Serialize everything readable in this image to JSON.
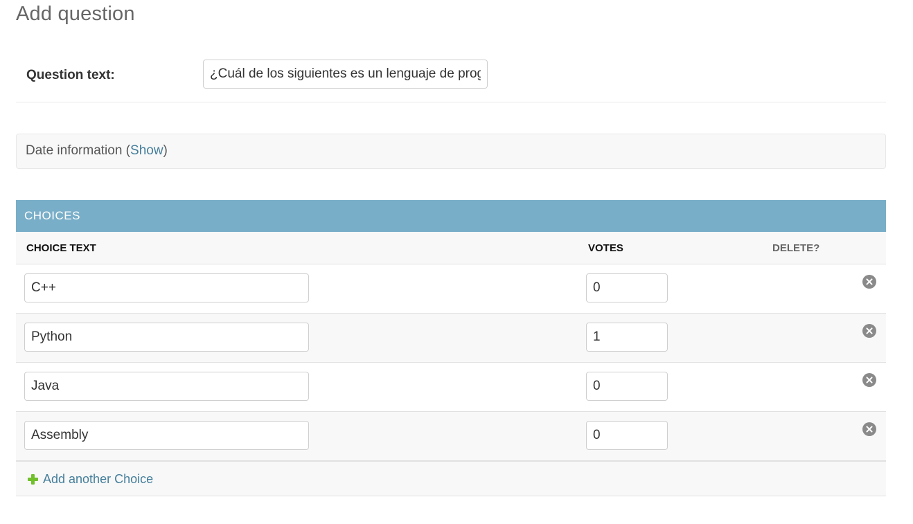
{
  "page": {
    "title": "Add question"
  },
  "question_field": {
    "label": "Question text:",
    "value": "¿Cuál de los siguientes es un lenguaje de programación?"
  },
  "date_section": {
    "title_prefix": "Date information (",
    "show_link": "Show",
    "title_suffix": ")"
  },
  "choices": {
    "header": "CHOICES",
    "columns": {
      "choice_text": "CHOICE TEXT",
      "votes": "VOTES",
      "delete": "DELETE?"
    },
    "rows": [
      {
        "choice_text": "C++",
        "votes": "0"
      },
      {
        "choice_text": "Python",
        "votes": "1"
      },
      {
        "choice_text": "Java",
        "votes": "0"
      },
      {
        "choice_text": "Assembly",
        "votes": "0"
      }
    ],
    "add_label": "Add another Choice"
  },
  "colors": {
    "header_bg": "#79aec8",
    "link": "#447e9b",
    "add_icon": "#70bf2b",
    "delete_icon": "#8a8a8a"
  },
  "icons": {
    "delete": "delete-circle-x-icon",
    "add": "plus-icon"
  }
}
